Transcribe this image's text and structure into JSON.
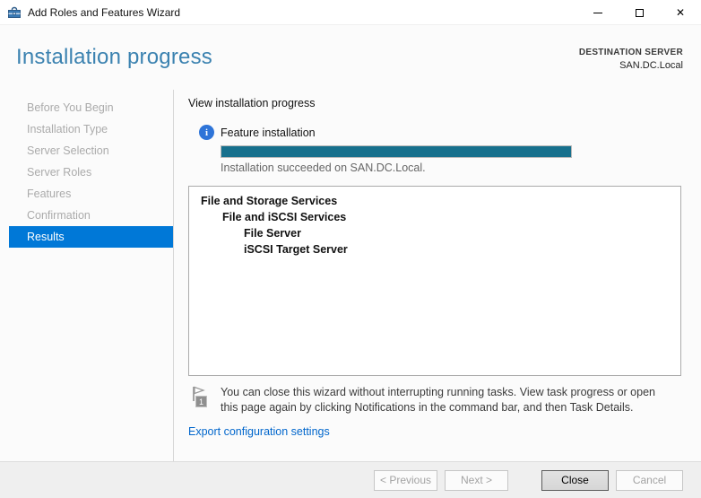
{
  "window": {
    "title": "Add Roles and Features Wizard",
    "icons": {
      "close_glyph": "✕"
    }
  },
  "header": {
    "title": "Installation progress",
    "destination_label": "DESTINATION SERVER",
    "destination_value": "SAN.DC.Local"
  },
  "sidebar": {
    "items": [
      {
        "label": "Before You Begin",
        "state": "disabled"
      },
      {
        "label": "Installation Type",
        "state": "disabled"
      },
      {
        "label": "Server Selection",
        "state": "disabled"
      },
      {
        "label": "Server Roles",
        "state": "disabled"
      },
      {
        "label": "Features",
        "state": "disabled"
      },
      {
        "label": "Confirmation",
        "state": "disabled"
      },
      {
        "label": "Results",
        "state": "selected"
      }
    ]
  },
  "main": {
    "section_title": "View installation progress",
    "progress": {
      "label": "Feature installation",
      "percent": 100,
      "fill_style": "width:100%",
      "status": "Installation succeeded on SAN.DC.Local."
    },
    "installed_features": [
      {
        "label": "File and Storage Services",
        "indent": 0
      },
      {
        "label": "File and iSCSI Services",
        "indent": 1
      },
      {
        "label": "File Server",
        "indent": 2
      },
      {
        "label": "iSCSI Target Server",
        "indent": 2
      }
    ],
    "note": {
      "badge": "1",
      "text": "You can close this wizard without interrupting running tasks. View task progress or open this page again by clicking Notifications in the command bar, and then Task Details."
    },
    "export_link": "Export configuration settings"
  },
  "footer": {
    "buttons": [
      {
        "label": "< Previous",
        "state": "disabled"
      },
      {
        "label": "Next >",
        "state": "disabled"
      },
      {
        "label": "Close",
        "state": "default"
      },
      {
        "label": "Cancel",
        "state": "disabled"
      }
    ]
  },
  "colors": {
    "accent_blue": "#0078d7",
    "header_blue": "#3b82b0",
    "progress_teal": "#17708d",
    "info_blue": "#2e74d8",
    "link_blue": "#0066cc"
  }
}
